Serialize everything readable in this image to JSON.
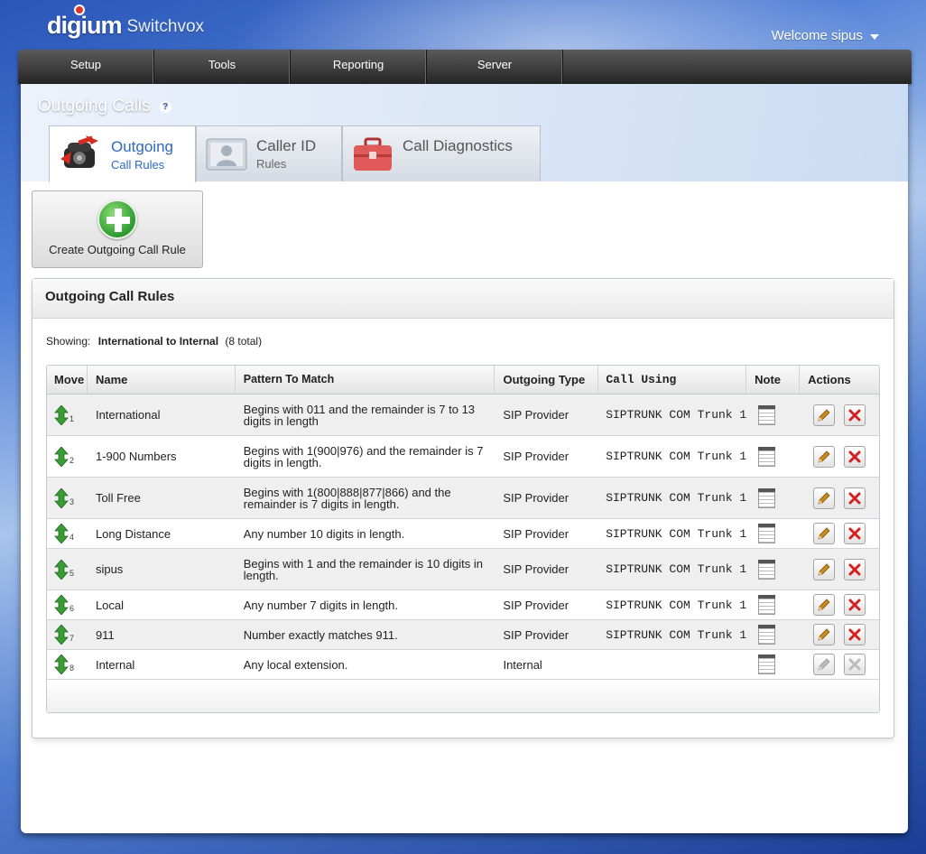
{
  "header": {
    "brand": "digium",
    "product": "Switchvox",
    "welcome": "Welcome sipus"
  },
  "menu": [
    "Setup",
    "Tools",
    "Reporting",
    "Server"
  ],
  "page": {
    "title": "Outgoing Calls",
    "help": "?"
  },
  "tabs": [
    {
      "title": "Outgoing",
      "sub": "Call Rules"
    },
    {
      "title": "Caller ID",
      "sub": "Rules"
    },
    {
      "title": "Call Diagnostics",
      "sub": ""
    }
  ],
  "create_button": {
    "label": "Create Outgoing Call Rule"
  },
  "rules": {
    "heading": "Outgoing Call Rules",
    "showing_label": "Showing:",
    "showing_value": "International to Internal",
    "showing_total": "(8 total)",
    "columns": [
      "Move",
      "Name",
      "Pattern To Match",
      "Outgoing Type",
      "Call Using",
      "Note",
      "Actions"
    ],
    "rows": [
      {
        "num": "1",
        "name": "International",
        "pattern": "Begins with 011 and the remainder is 7 to 13 digits in length",
        "type": "SIP Provider",
        "using": "SIPTRUNK COM Trunk 1",
        "enabled": true
      },
      {
        "num": "2",
        "name": "1-900 Numbers",
        "pattern": "Begins with 1(900|976) and the remainder is 7 digits in length.",
        "type": "SIP Provider",
        "using": "SIPTRUNK COM Trunk 1",
        "enabled": true
      },
      {
        "num": "3",
        "name": "Toll Free",
        "pattern": "Begins with 1(800|888|877|866) and the remainder is 7 digits in length.",
        "type": "SIP Provider",
        "using": "SIPTRUNK COM Trunk 1",
        "enabled": true
      },
      {
        "num": "4",
        "name": "Long Distance",
        "pattern": "Any number 10 digits in length.",
        "type": "SIP Provider",
        "using": "SIPTRUNK COM Trunk 1",
        "enabled": true
      },
      {
        "num": "5",
        "name": "sipus",
        "pattern": "Begins with 1 and the remainder is 10 digits in length.",
        "type": "SIP Provider",
        "using": "SIPTRUNK COM Trunk 1",
        "enabled": true
      },
      {
        "num": "6",
        "name": "Local",
        "pattern": "Any number 7 digits in length.",
        "type": "SIP Provider",
        "using": "SIPTRUNK COM Trunk 1",
        "enabled": true
      },
      {
        "num": "7",
        "name": "911",
        "pattern": "Number exactly matches 911.",
        "type": "SIP Provider",
        "using": "SIPTRUNK COM Trunk 1",
        "enabled": true
      },
      {
        "num": "8",
        "name": "Internal",
        "pattern": "Any local extension.",
        "type": "Internal",
        "using": "",
        "enabled": false
      }
    ]
  },
  "colors": {
    "accent_blue": "#2d6ac0",
    "delete_red": "#d42020",
    "move_green": "#3a9a36"
  }
}
